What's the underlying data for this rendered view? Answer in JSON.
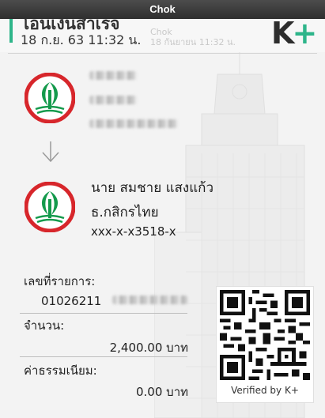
{
  "window": {
    "title": "Chok"
  },
  "header": {
    "title": "โอนเงินสำเร็จ",
    "datetime": "18 ก.ย. 63  11:32 น.",
    "ghost_line1": "Chok",
    "ghost_line2": "18 กันยายน 11:32 น.",
    "brand": "K",
    "brand_plus": "+"
  },
  "receiver": {
    "name": "นาย สมชาย แสงแก้ว",
    "bank": "ธ.กสิกรไทย",
    "account": "xxx-x-x3518-x"
  },
  "transaction": {
    "ref_label": "เลขที่รายการ:",
    "ref_value": "01026211",
    "amount_label": "จำนวน:",
    "amount_value": "2,400.00 บาท",
    "fee_label": "ค่าธรรมเนียม:",
    "fee_value": "0.00 บาท"
  },
  "qr": {
    "caption": "Verified by K+"
  },
  "colors": {
    "accent": "#2eb58a",
    "bank_red": "#d7262b",
    "bank_green": "#149a4c"
  },
  "icons": [
    "kbank-logo-icon",
    "down-arrow-icon",
    "qr-code-icon"
  ]
}
